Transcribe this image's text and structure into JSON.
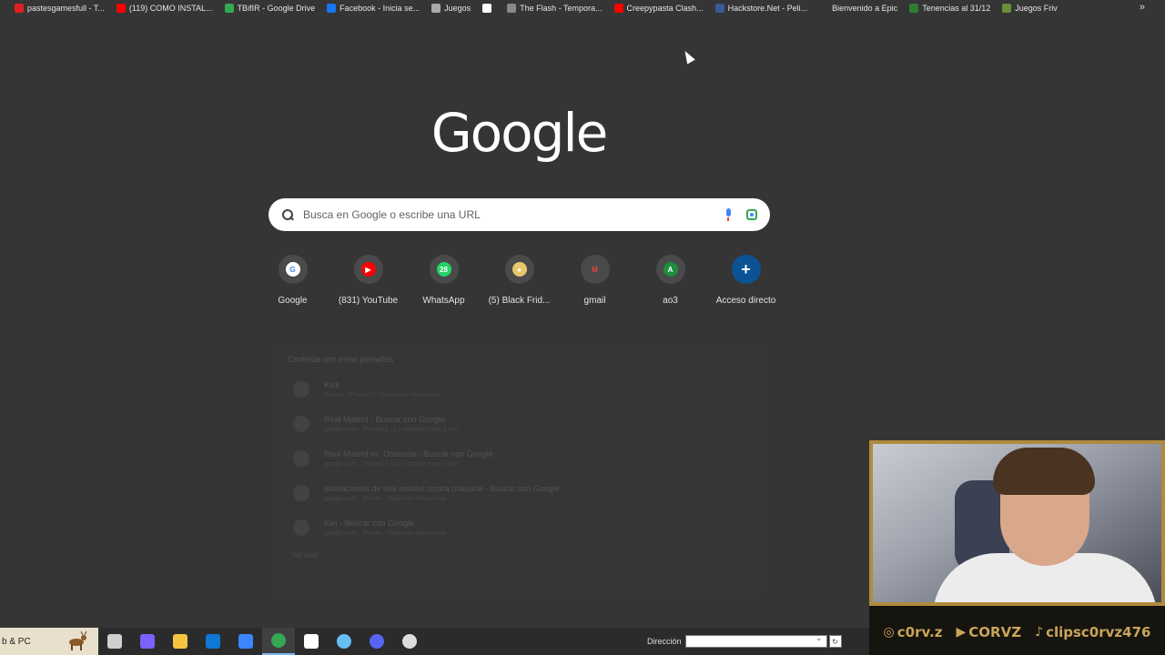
{
  "bookmarks": [
    {
      "label": "pastesgamesfull - T...",
      "color": "#e02020"
    },
    {
      "label": "(119) COMO INSTAL...",
      "color": "#ff0000"
    },
    {
      "label": "TBifIR - Google Drive",
      "color": "#34a853"
    },
    {
      "label": "Facebook - Inicia se...",
      "color": "#1877f2"
    },
    {
      "label": "Juegos",
      "color": "#aaaaaa"
    },
    {
      "label": "",
      "color": "#ffffff"
    },
    {
      "label": "The Flash - Tempora...",
      "color": "#888888"
    },
    {
      "label": "Creepypasta Clash...",
      "color": "#ff0000"
    },
    {
      "label": "Hackstore.Net - Peli...",
      "color": "#3b5998"
    },
    {
      "label": "Bienvenido a Epic",
      "color": "#333333"
    },
    {
      "label": "Tenencias al 31/12",
      "color": "#2e7d32"
    },
    {
      "label": "Juegos Friv",
      "color": "#6a8f3a"
    }
  ],
  "bookmarks_more": "»",
  "logo_text": "Google",
  "search": {
    "placeholder": "Busca en Google o escribe una URL"
  },
  "shortcuts": [
    {
      "label": "Google",
      "icon": "G",
      "bg": "#ffffff",
      "fg": "#4285f4"
    },
    {
      "label": "(831) YouTube",
      "icon": "▶",
      "bg": "#ff0000",
      "fg": "#ffffff"
    },
    {
      "label": "WhatsApp",
      "icon": "28",
      "bg": "#25d366",
      "fg": "#ffffff"
    },
    {
      "label": "(5) Black Frid...",
      "icon": "●",
      "bg": "#e8c76a",
      "fg": "#ffffff"
    },
    {
      "label": "gmail",
      "icon": "M",
      "bg": "#4a4a4a",
      "fg": "#ea4335"
    },
    {
      "label": "ao3",
      "icon": "A",
      "bg": "#1e8e3e",
      "fg": "#ffffff"
    },
    {
      "label": "Acceso directo",
      "icon": "+",
      "bg": "#0b5394",
      "fg": "#ffffff"
    }
  ],
  "continue": {
    "title": "Continúa con estas pestañas",
    "more": "⋮",
    "rows": [
      {
        "title": "Kick",
        "sub": "Buscar · Phone13 · Visita con frecuencia"
      },
      {
        "title": "Real Madrid - Buscar con Google",
        "sub": "google.com · Phone13 · Lo visitaste hace 1 min"
      },
      {
        "title": "Real Madrid vs. Osasuna - Buscar con Google",
        "sub": "google.com · Phone13 · Lo visitaste hace 1 min"
      },
      {
        "title": "alineaciones de real madrid contra osasuna - Buscar con Google",
        "sub": "google.com · Phone · Visita con frecuencia"
      },
      {
        "title": "Kivi - Buscar con Google",
        "sub": "google.com · Phone · Visita con frecuencia"
      }
    ],
    "ver_mas": "Ver más"
  },
  "taskbar": {
    "left_text": "b & PC",
    "apps": [
      {
        "name": "task-view",
        "color": "#cfcfcf"
      },
      {
        "name": "copilot",
        "color": "#7b61ff"
      },
      {
        "name": "file-explorer",
        "color": "#f5c542"
      },
      {
        "name": "outlook",
        "color": "#0f78d4"
      },
      {
        "name": "store",
        "color": "#3a86ff"
      },
      {
        "name": "chrome",
        "color": "#34a853"
      },
      {
        "name": "capcut",
        "color": "#ffffff"
      },
      {
        "name": "steam",
        "color": "#66c0f4"
      },
      {
        "name": "discord",
        "color": "#5865f2"
      },
      {
        "name": "obs",
        "color": "#dddddd"
      }
    ],
    "address_label": "Dirección",
    "go_icon": "↻"
  },
  "webcam": {
    "socials": [
      {
        "icon": "◎",
        "label": "c0rv.z"
      },
      {
        "icon": "▶",
        "label": "CORVZ"
      },
      {
        "icon": "♪",
        "label": "clipsc0rvz476"
      }
    ]
  }
}
